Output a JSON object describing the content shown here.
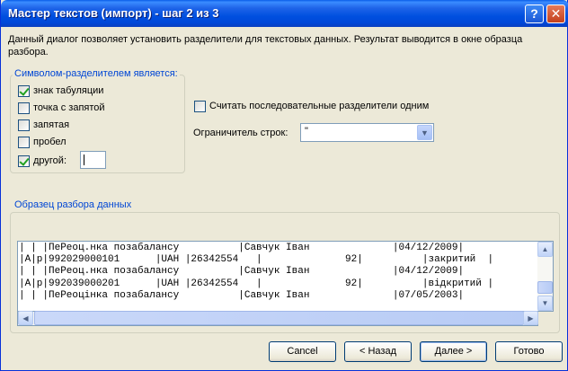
{
  "window": {
    "title": "Мастер текстов (импорт) - шаг 2 из 3",
    "help_glyph": "?",
    "close_glyph": "✕"
  },
  "description": "Данный диалог позволяет установить разделители для текстовых данных. Результат выводится в окне образца разбора.",
  "delimiters": {
    "group_label": "Символом-разделителем является:",
    "items": [
      {
        "label": "знак табуляции",
        "checked": true
      },
      {
        "label": "точка с запятой",
        "checked": false
      },
      {
        "label": "запятая",
        "checked": false
      },
      {
        "label": "пробел",
        "checked": false
      },
      {
        "label": "другой:",
        "checked": true
      }
    ],
    "other_value": "|"
  },
  "consecutive": {
    "label": "Считать последовательные разделители одним",
    "checked": false
  },
  "qualifier": {
    "label": "Ограничитель строк:",
    "value": "\"",
    "dropdown_icon": "chevron-down-icon"
  },
  "preview": {
    "group_label": "Образец разбора данных",
    "lines": [
      "| | |ПеРеоц.нка позабалансу          |Савчук Іван              |04/12/2009|",
      "|А|р|992029000101      |UAH |26342554   |              92|          |закритий  |",
      "| | |ПеРеоц.нка позабалансу          |Савчук Іван              |04/12/2009|",
      "|А|р|992039000201      |UAH |26342554   |              92|          |відкритий |",
      "| | |ПеРеоцінка позабалансу          |Савчук Іван              |07/05/2003|"
    ]
  },
  "buttons": {
    "cancel": "Cancel",
    "back": "< Назад",
    "next": "Далее >",
    "finish": "Готово"
  },
  "colors": {
    "title_bar": "#0050e0",
    "group_label": "#0046d5",
    "dialog_bg": "#ece9d8",
    "checkmark": "#21a121"
  }
}
